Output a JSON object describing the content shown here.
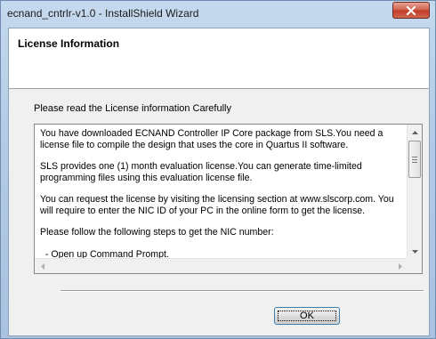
{
  "window": {
    "title": "ecnand_cntrlr-v1.0 - InstallShield Wizard",
    "close_icon": "close-icon"
  },
  "header": {
    "title": "License Information"
  },
  "main": {
    "prompt": "Please read the License information Carefully",
    "license_paragraphs": [
      "You have downloaded ECNAND Controller IP Core package from SLS.You need a license file to compile the design that uses the core in Quartus II software.",
      "SLS provides one (1) month evaluation license.You can generate time-limited programming files using this evaluation license file.",
      "You can request the license by visiting the licensing section at www.slscorp.com. You will require to enter the NIC ID of your PC in the online form to get the license.",
      "Please follow the following steps to get the NIC number:",
      "  - Open up Command Prompt."
    ]
  },
  "footer": {
    "ok_label": "OK"
  },
  "colors": {
    "title_bar": "#b3cbe6",
    "close_button": "#c13d26",
    "dialog_background": "#f0f0f0",
    "button_border": "#3c7fb1"
  }
}
